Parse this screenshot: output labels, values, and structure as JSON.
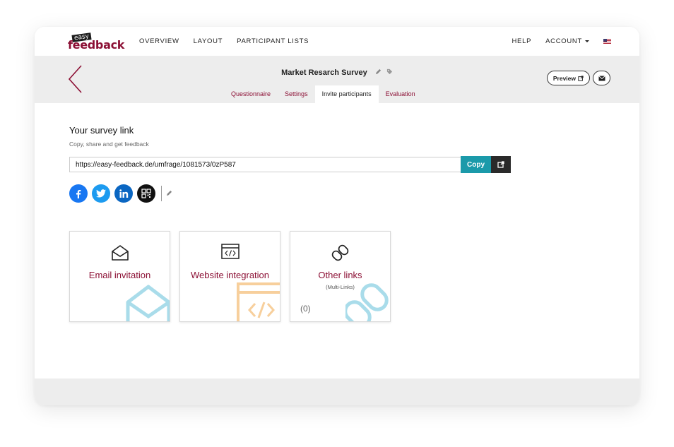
{
  "brand": {
    "logo_small": "easy",
    "logo_main": "feedback",
    "color": "#8c1035"
  },
  "nav": {
    "items": [
      {
        "label": "OVERVIEW"
      },
      {
        "label": "LAYOUT"
      },
      {
        "label": "PARTICIPANT LISTS"
      }
    ],
    "help": "HELP",
    "account": "ACCOUNT",
    "language_icon": "us-flag-icon"
  },
  "survey": {
    "title": "Market Resarch Survey",
    "tabs": [
      {
        "label": "Questionnaire",
        "active": false
      },
      {
        "label": "Settings",
        "active": false
      },
      {
        "label": "Invite participants",
        "active": true
      },
      {
        "label": "Evaluation",
        "active": false
      }
    ],
    "preview_label": "Preview"
  },
  "link_section": {
    "heading": "Your survey link",
    "subheading": "Copy, share and get feedback",
    "url": "https://easy-feedback.de/umfrage/1081573/0zP587",
    "copy_label": "Copy",
    "copy_color": "#1b9aaa",
    "share_icons": [
      "facebook-icon",
      "twitter-icon",
      "linkedin-icon",
      "qr-code-icon"
    ]
  },
  "cards": [
    {
      "title": "Email invitation",
      "icon": "envelope-open-icon"
    },
    {
      "title": "Website integration",
      "icon": "code-window-icon"
    },
    {
      "title": "Other links",
      "subtitle": "(Multi-Links)",
      "count": "(0)",
      "icon": "chain-link-icon"
    }
  ]
}
